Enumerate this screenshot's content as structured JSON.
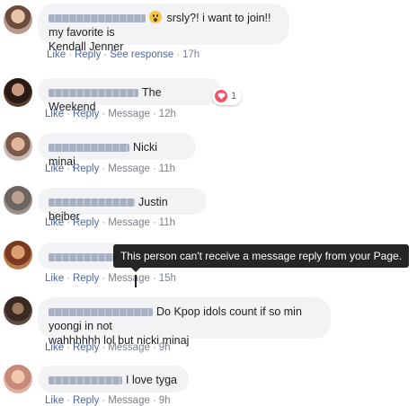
{
  "comments": [
    {
      "text_before": "srsly?! i want to join!! my favorite is",
      "text_after": "Kendall Jenner",
      "emoji": "surprised-face-icon",
      "actions": [
        "Like",
        "Reply",
        "See response"
      ],
      "time": "17h"
    },
    {
      "text": "The Weekend",
      "reaction_count": "1",
      "actions": [
        "Like",
        "Reply",
        "Message"
      ],
      "time": "12h"
    },
    {
      "text": "Nicki minaj",
      "actions": [
        "Like",
        "Reply",
        "Message"
      ],
      "time": "11h"
    },
    {
      "text": "Justin beiber",
      "actions": [
        "Like",
        "Reply",
        "Message"
      ],
      "time": "11h"
    },
    {
      "text": "",
      "actions": [
        "Like",
        "Reply",
        "Message"
      ],
      "time": "15h"
    },
    {
      "text_line1": "Do Kpop idols count if so min yoongi in not",
      "text_line2": "wahhhhhh lol but nicki minaj",
      "actions": [
        "Like",
        "Reply",
        "Message"
      ],
      "time": "9h"
    },
    {
      "text": "I love tyga",
      "actions": [
        "Like",
        "Reply",
        "Message"
      ],
      "time": "9h"
    }
  ],
  "tooltip": "This person can't receive a message reply from your Page.",
  "colors": {
    "link": "#4b67a1",
    "bubble": "#f2f3f5",
    "heart": "#f25268"
  }
}
